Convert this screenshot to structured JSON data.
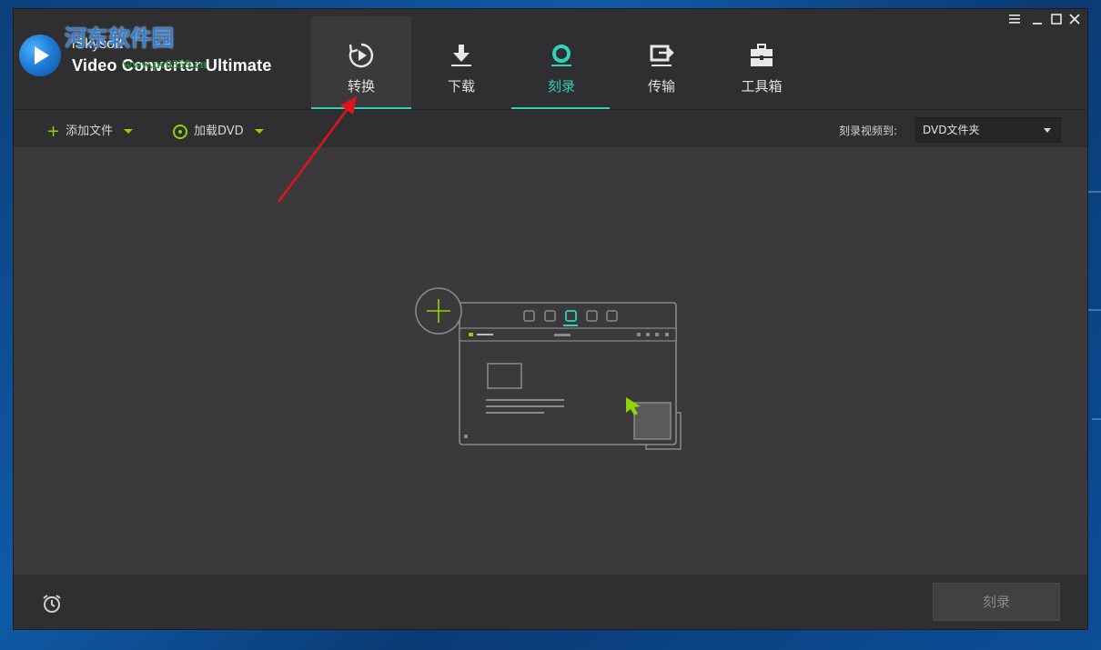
{
  "watermark": {
    "site_name": "河东软件园",
    "url": "www.pc0359.cn"
  },
  "app": {
    "brand_small": "iSkysoft",
    "brand_big": "Video Converter Ultimate"
  },
  "window_controls": [
    "menu-icon",
    "minimize-icon",
    "maximize-icon",
    "close-icon"
  ],
  "nav": {
    "items": [
      {
        "label": "转换",
        "icon": "convert-icon",
        "state": "hover"
      },
      {
        "label": "下载",
        "icon": "download-icon",
        "state": "normal"
      },
      {
        "label": "刻录",
        "icon": "burn-icon",
        "state": "active"
      },
      {
        "label": "传输",
        "icon": "transfer-icon",
        "state": "normal"
      },
      {
        "label": "工具箱",
        "icon": "toolbox-icon",
        "state": "normal"
      }
    ]
  },
  "toolbar": {
    "add_files_label": "添加文件",
    "load_dvd_label": "加载DVD",
    "burn_to_label": "刻录视频到:",
    "burn_to_value": "DVD文件夹"
  },
  "bottom": {
    "burn_button_label": "刻录"
  },
  "colors": {
    "accent": "#2dd4b9",
    "green": "#8fd400",
    "arrow": "#e0141c"
  }
}
